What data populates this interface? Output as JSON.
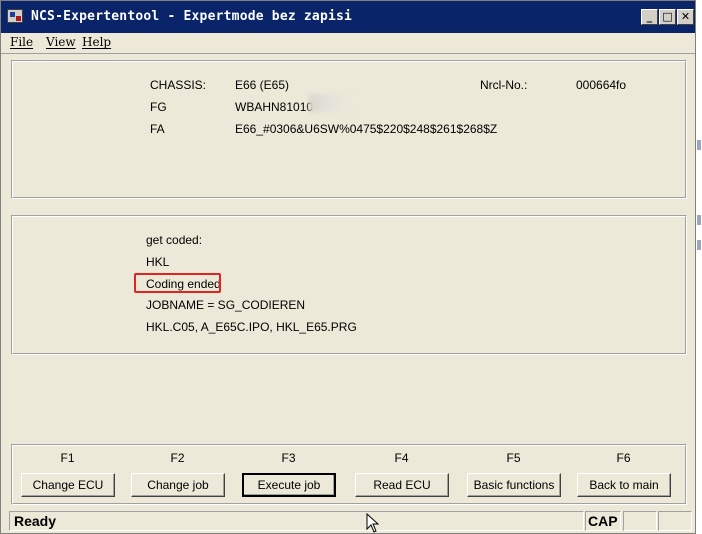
{
  "window": {
    "title": "NCS-Expertentool - Expertmode bez zapisi",
    "controls": {
      "minimize": "_",
      "maximize": "□",
      "close": "✕"
    }
  },
  "menu": {
    "items": [
      "File",
      "View",
      "Help"
    ]
  },
  "vehicle": {
    "chassis_label": "CHASSIS:",
    "chassis_value": "E66 (E65)",
    "nrcl_label": "Nrcl-No.:",
    "nrcl_value": "000664fo",
    "fg_label": "FG",
    "fg_value": "WBAHN81010",
    "fa_label": "FA",
    "fa_value": "E66_#0306&U6SW%0475$220$248$261$268$Z"
  },
  "log": {
    "lines": [
      "get coded:",
      "HKL",
      "Coding ended",
      "JOBNAME = SG_CODIEREN",
      "HKL.C05, A_E65C.IPO, HKL_E65.PRG"
    ],
    "highlighted_index": 2,
    "highlight_color": "#e02424"
  },
  "function_keys": [
    {
      "key": "F1",
      "label": "Change ECU"
    },
    {
      "key": "F2",
      "label": "Change job"
    },
    {
      "key": "F3",
      "label": "Execute job"
    },
    {
      "key": "F4",
      "label": "Read ECU"
    },
    {
      "key": "F5",
      "label": "Basic functions"
    },
    {
      "key": "F6",
      "label": "Back to main"
    }
  ],
  "status": {
    "text": "Ready",
    "caps": "CAP"
  },
  "colors": {
    "title_bar": "#0a246a",
    "face": "#ece9d8"
  }
}
